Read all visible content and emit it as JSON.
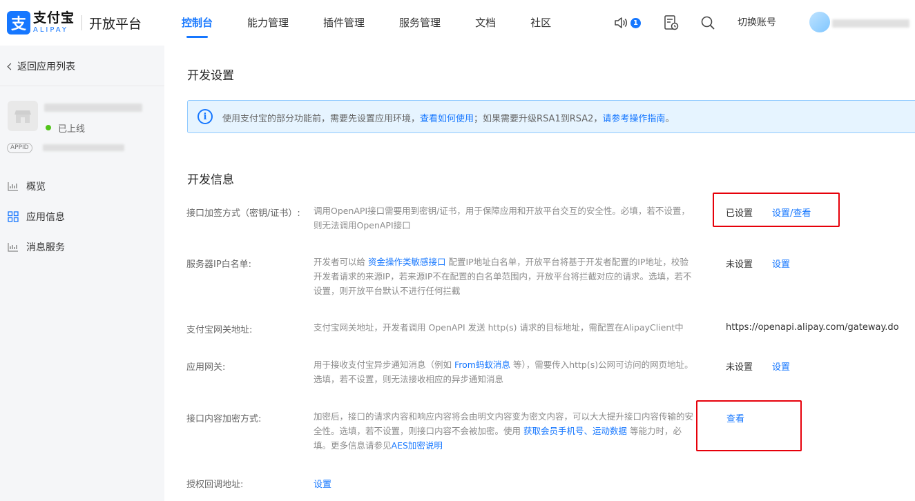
{
  "header": {
    "logo_mark": "支",
    "logo_cn": "支付宝",
    "logo_en": "ALIPAY",
    "platform": "开放平台",
    "nav": [
      "控制台",
      "能力管理",
      "插件管理",
      "服务管理",
      "文档",
      "社区"
    ],
    "notification_count": "1",
    "switch_account": "切换账号"
  },
  "sidebar": {
    "back": "返回应用列表",
    "status": "已上线",
    "appid_tag": "APPID",
    "items": [
      "概览",
      "应用信息",
      "消息服务"
    ]
  },
  "main": {
    "dev_settings_title": "开发设置",
    "notice": {
      "text1": "使用支付宝的部分功能前，需要先设置应用环境，",
      "link1": "查看如何使用",
      "text2": "；如果需要升级RSA1到RSA2，",
      "link2": "请参考操作指南",
      "text3": "。"
    },
    "dev_info_title": "开发信息",
    "rows": {
      "sign": {
        "label": "接口加签方式（密钥/证书）:",
        "desc": "调用OpenAPI接口需要用到密钥/证书，用于保障应用和开放平台交互的安全性。必填，若不设置，则无法调用OpenAPI接口",
        "status": "已设置",
        "action": "设置/查看"
      },
      "ip_whitelist": {
        "label": "服务器IP白名单:",
        "desc_a": "开发者可以给 ",
        "desc_link": "资金操作类敏感接口",
        "desc_b": " 配置IP地址白名单，开放平台将基于开发者配置的IP地址，校验开发者请求的来源IP，若来源IP不在配置的白名单范围内，开放平台将拦截对应的请求。选填，若不设置，则开放平台默认不进行任何拦截",
        "status": "未设置",
        "action": "设置"
      },
      "gateway": {
        "label": "支付宝网关地址:",
        "desc": "支付宝网关地址，开发者调用 OpenAPI 发送 http(s) 请求的目标地址，需配置在AlipayClient中",
        "value": "https://openapi.alipay.com/gateway.do"
      },
      "app_gateway": {
        "label": "应用网关:",
        "desc_a": "用于接收支付宝异步通知消息（例如 ",
        "desc_link": "From蚂蚁消息",
        "desc_b": " 等），需要传入http(s)公网可访问的网页地址。选填，若不设置，则无法接收相应的异步通知消息",
        "status": "未设置",
        "action": "设置"
      },
      "encrypt": {
        "label": "接口内容加密方式:",
        "desc_a": "加密后，接口的请求内容和响应内容将会由明文内容变为密文内容，可以大大提升接口内容传输的安全性。选填，若不设置，则接口内容不会被加密。使用 ",
        "desc_link1": "获取会员手机号",
        "desc_sep": "、",
        "desc_link2": "运动数据",
        "desc_b": " 等能力时，必填。更多信息请参见",
        "desc_link3": "AES加密说明",
        "action": "查看"
      },
      "callback": {
        "label": "授权回调地址:",
        "action": "设置"
      }
    }
  },
  "colors": {
    "accent": "#1677ff",
    "highlight": "#e6000a",
    "online": "#52c41a"
  }
}
